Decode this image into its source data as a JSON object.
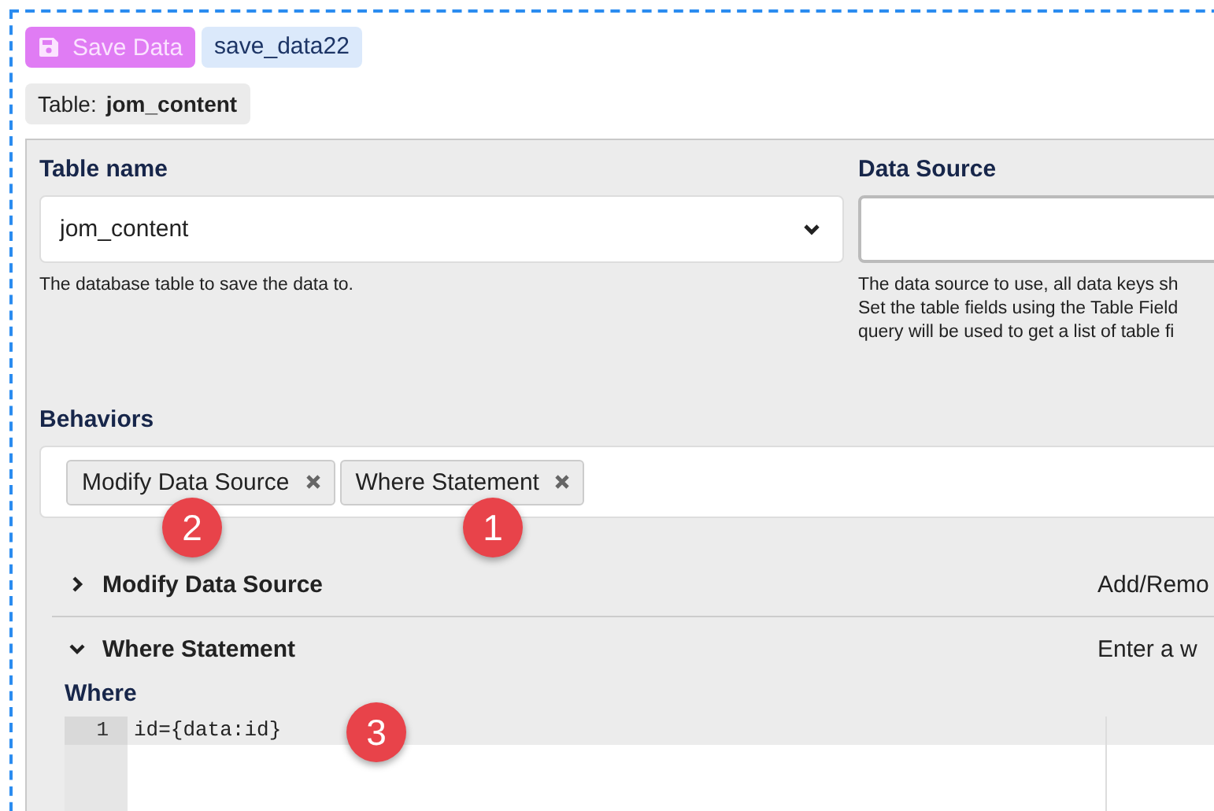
{
  "toolbar": {
    "save_button": "Save Data",
    "name_badge": "save_data22"
  },
  "table_chip": {
    "label": "Table:",
    "value": "jom_content"
  },
  "table_name": {
    "label": "Table name",
    "value": "jom_content",
    "help": "The database table to save the data to."
  },
  "data_source": {
    "label": "Data Source",
    "help_lines": [
      "The data source to use, all data keys sh",
      "Set the table fields using the Table Field",
      "query will be used to get a list of table fi"
    ]
  },
  "behaviors": {
    "label": "Behaviors",
    "tags": [
      {
        "label": "Modify Data Source",
        "marker": "2"
      },
      {
        "label": "Where Statement",
        "marker": "1"
      }
    ]
  },
  "sections": [
    {
      "title": "Modify Data Source",
      "description": "Add/Remo",
      "expanded": false
    },
    {
      "title": "Where Statement",
      "description": "Enter a w",
      "expanded": true,
      "field": {
        "label": "Where",
        "lines": [
          {
            "number": "1",
            "code": "id={data:id}",
            "marker": "3"
          }
        ]
      }
    }
  ]
}
